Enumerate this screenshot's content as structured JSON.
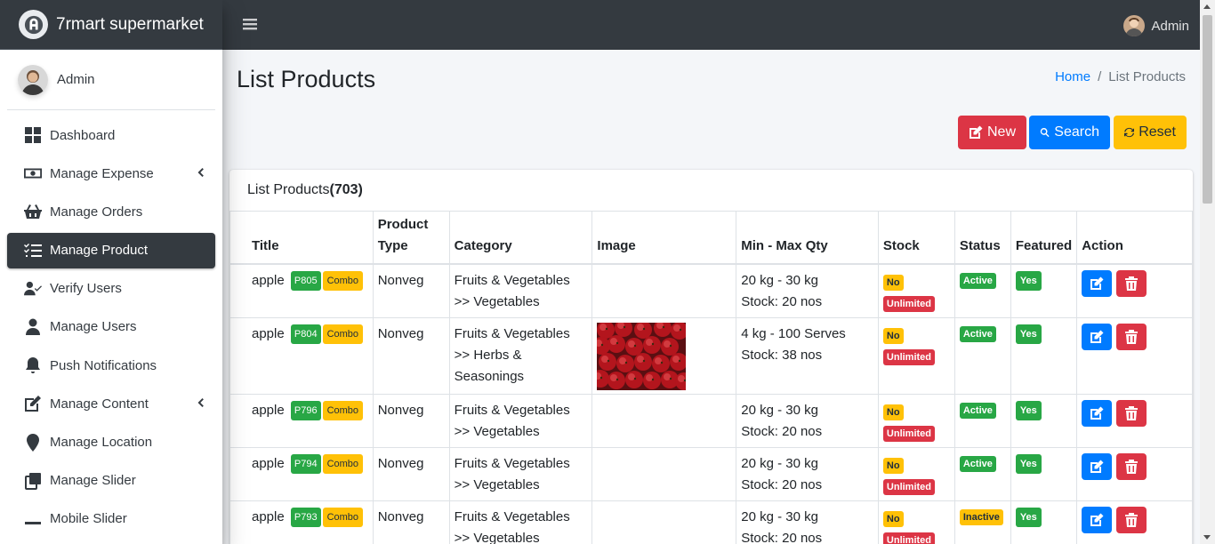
{
  "brand": {
    "name": "7rmart supermarket"
  },
  "sidebar": {
    "user": "Admin",
    "items": [
      {
        "label": "Dashboard",
        "icon": "dashboard-icon"
      },
      {
        "label": "Manage Expense",
        "icon": "money-icon",
        "has_arrow": true
      },
      {
        "label": "Manage Orders",
        "icon": "basket-icon"
      },
      {
        "label": "Manage Product",
        "icon": "list-check-icon",
        "active": true
      },
      {
        "label": "Verify Users",
        "icon": "user-check-icon"
      },
      {
        "label": "Manage Users",
        "icon": "user-icon"
      },
      {
        "label": "Push Notifications",
        "icon": "bell-icon"
      },
      {
        "label": "Manage Content",
        "icon": "edit-icon",
        "has_arrow": true
      },
      {
        "label": "Manage Location",
        "icon": "map-marker-icon"
      },
      {
        "label": "Manage Slider",
        "icon": "slider-icon"
      },
      {
        "label": "Mobile Slider",
        "icon": "minus-icon"
      }
    ]
  },
  "header": {
    "user": "Admin"
  },
  "page": {
    "title": "List Products",
    "breadcrumb": {
      "home": "Home",
      "current": "List Products"
    }
  },
  "toolbar": {
    "new_label": "New",
    "search_label": "Search",
    "reset_label": "Reset"
  },
  "card": {
    "title": "List Products",
    "count": "(703)"
  },
  "table": {
    "headers": {
      "title": "Title",
      "type": "Product Type",
      "category": "Category",
      "image": "Image",
      "qty": "Min - Max Qty",
      "stock": "Stock",
      "status": "Status",
      "featured": "Featured",
      "action": "Action"
    },
    "rows": [
      {
        "title": "apple",
        "code": "P805",
        "tag": "Combo",
        "type": "Nonveg",
        "category": "Fruits & Vegetables >> Vegetables",
        "has_image": false,
        "qty": "20 kg - 30 kg",
        "stock_text": "Stock: 20 nos",
        "stock": "No",
        "stock_limit": "Unlimited",
        "status": "Active",
        "featured": "Yes"
      },
      {
        "title": "apple",
        "code": "P804",
        "tag": "Combo",
        "type": "Nonveg",
        "category": "Fruits & Vegetables >> Herbs & Seasonings",
        "has_image": true,
        "qty": "4 kg - 100 Serves",
        "stock_text": "Stock: 38 nos",
        "stock": "No",
        "stock_limit": "Unlimited",
        "status": "Active",
        "featured": "Yes"
      },
      {
        "title": "apple",
        "code": "P796",
        "tag": "Combo",
        "type": "Nonveg",
        "category": "Fruits & Vegetables >> Vegetables",
        "has_image": false,
        "qty": "20 kg - 30 kg",
        "stock_text": "Stock: 20 nos",
        "stock": "No",
        "stock_limit": "Unlimited",
        "status": "Active",
        "featured": "Yes"
      },
      {
        "title": "apple",
        "code": "P794",
        "tag": "Combo",
        "type": "Nonveg",
        "category": "Fruits & Vegetables >> Vegetables",
        "has_image": false,
        "qty": "20 kg - 30 kg",
        "stock_text": "Stock: 20 nos",
        "stock": "No",
        "stock_limit": "Unlimited",
        "status": "Active",
        "featured": "Yes"
      },
      {
        "title": "apple",
        "code": "P793",
        "tag": "Combo",
        "type": "Nonveg",
        "category": "Fruits & Vegetables >> Vegetables",
        "has_image": false,
        "qty": "20 kg - 30 kg",
        "stock_text": "Stock: 20 nos",
        "stock": "No",
        "stock_limit": "Unlimited",
        "status": "Inactive",
        "featured": "Yes"
      }
    ]
  },
  "colors": {
    "dark": "#343a40",
    "primary": "#007bff",
    "danger": "#dc3545",
    "warning": "#ffc107",
    "success": "#28a745"
  }
}
